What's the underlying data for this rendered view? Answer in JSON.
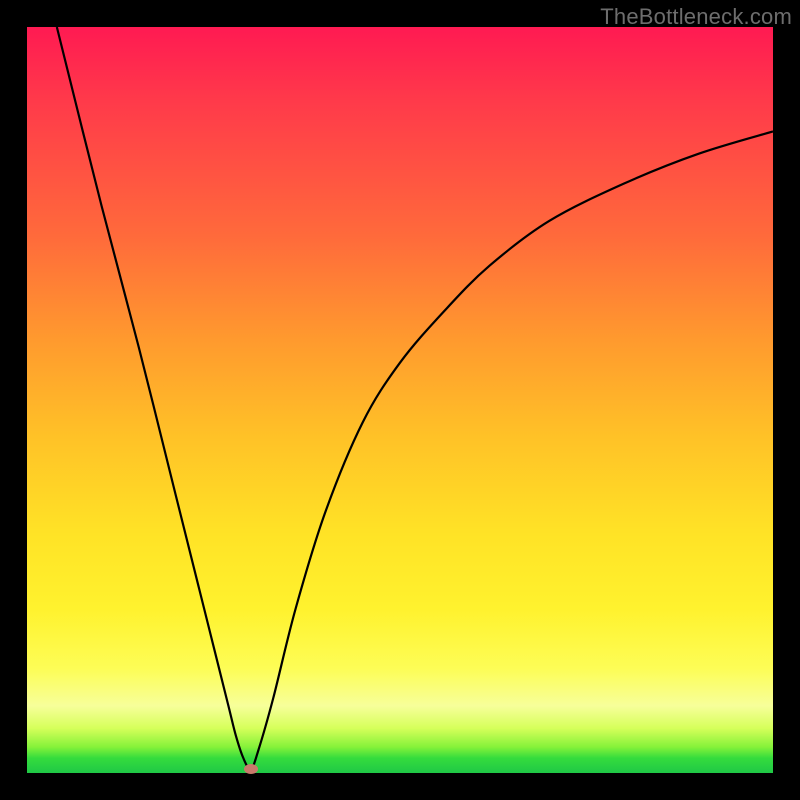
{
  "watermark": "TheBottleneck.com",
  "colors": {
    "frame": "#000000",
    "gradient_top": "#ff1a52",
    "gradient_bottom": "#1fc846",
    "curve_stroke": "#000000",
    "marker_fill": "#c97a6b"
  },
  "chart_data": {
    "type": "line",
    "title": "",
    "xlabel": "",
    "ylabel": "",
    "xlim": [
      0,
      100
    ],
    "ylim": [
      0,
      100
    ],
    "grid": false,
    "legend": false,
    "series": [
      {
        "name": "bottleneck-curve",
        "x": [
          4,
          10,
          15,
          20,
          23,
          25,
          27,
          28,
          29,
          30,
          31,
          33,
          36,
          40,
          45,
          50,
          56,
          62,
          70,
          80,
          90,
          100
        ],
        "values": [
          100,
          76,
          57,
          37,
          25,
          17,
          9,
          5,
          2,
          0.5,
          3,
          10,
          22,
          35,
          47,
          55,
          62,
          68,
          74,
          79,
          83,
          86
        ]
      }
    ],
    "marker": {
      "x": 30,
      "y": 0.5
    }
  }
}
